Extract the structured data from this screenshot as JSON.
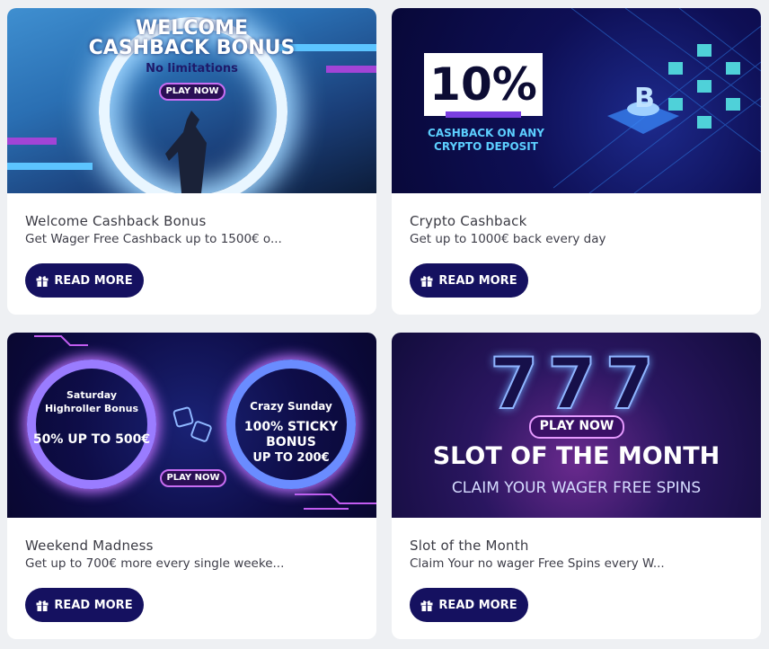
{
  "cards": [
    {
      "title": "Welcome Cashback Bonus",
      "description": "Get Wager Free Cashback up to 1500€ o...",
      "button": "READ MORE",
      "banner": {
        "line1": "WELCOME",
        "line2": "CASHBACK BONUS",
        "line3": "No limitations",
        "cta": "PLAY NOW"
      }
    },
    {
      "title": "Crypto Cashback",
      "description": "Get up to 1000€ back every day",
      "button": "READ MORE",
      "banner": {
        "percent": "10%",
        "line1": "CASHBACK ON ANY",
        "line2": "CRYPTO DEPOSIT"
      }
    },
    {
      "title": "Weekend Madness",
      "description": "Get up to 700€ more every single weeke...",
      "button": "READ MORE",
      "banner": {
        "sat1": "Saturday",
        "sat2": "Highroller Bonus",
        "sat3": "50% UP TO 500€",
        "sun1": "Crazy Sunday",
        "sun2": "100% STICKY",
        "sun3": "BONUS",
        "sun4": "UP TO 200€",
        "cta": "PLAY NOW"
      }
    },
    {
      "title": "Slot of the Month",
      "description": "Claim Your no wager Free Spins every W...",
      "button": "READ MORE",
      "banner": {
        "sevens": "777",
        "cta": "PLAY NOW",
        "line1": "SLOT OF THE MONTH",
        "line2": "CLAIM YOUR WAGER FREE SPINS"
      }
    }
  ],
  "icons": {
    "button_icon": "gift-icon"
  }
}
